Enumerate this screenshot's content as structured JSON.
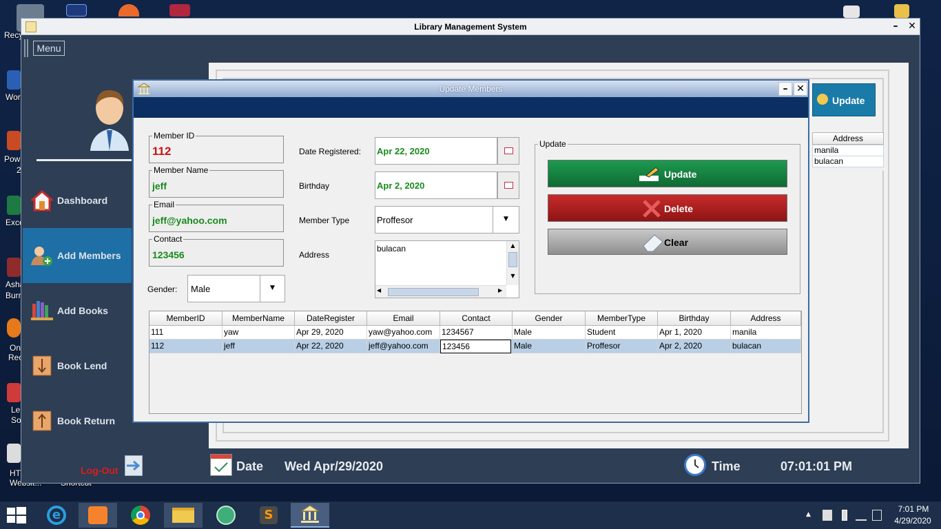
{
  "desktop": {
    "icons": [
      {
        "label": "Recy"
      },
      {
        "label": "Wor"
      },
      {
        "label": "Pow"
      },
      {
        "label": "2"
      },
      {
        "label": "Exce"
      },
      {
        "label": "Asha"
      },
      {
        "label": "Burn"
      },
      {
        "label": "On"
      },
      {
        "label": "Rec"
      },
      {
        "label": "Le"
      },
      {
        "label": "So"
      },
      {
        "label": "HT"
      },
      {
        "label": "Websit..."
      },
      {
        "label": "Shortcut"
      }
    ]
  },
  "main_window": {
    "title": "Library Management System",
    "minimize": "–",
    "close": "✕",
    "menu_label": "Menu",
    "sidebar": [
      {
        "label": "Dashboard",
        "icon": "house-icon"
      },
      {
        "label": "Add Members",
        "icon": "add-member-icon",
        "active": true
      },
      {
        "label": "Add Books",
        "icon": "books-icon"
      },
      {
        "label": "Book Lend",
        "icon": "lend-icon"
      },
      {
        "label": "Book Return",
        "icon": "return-icon"
      }
    ],
    "logout_label": "Log-Out",
    "background_update_label": "Update",
    "background_address_header": "Address",
    "background_addresses": [
      "manila",
      "bulacan"
    ],
    "status": {
      "date_label": "Date",
      "date_value": "Wed Apr/29/2020",
      "time_label": "Time",
      "time_value": "07:01:01 PM"
    }
  },
  "dialog": {
    "title": "Update Members",
    "minimize": "–",
    "close": "✕",
    "member_id": {
      "caption": "Member ID",
      "value": "112"
    },
    "member_name": {
      "caption": "Member Name",
      "value": "jeff"
    },
    "email": {
      "caption": "Email",
      "value": "jeff@yahoo.com"
    },
    "contact": {
      "caption": "Contact",
      "value": "123456"
    },
    "gender": {
      "label": "Gender:",
      "value": "Male"
    },
    "date_registered": {
      "label": "Date Registered:",
      "value": "Apr 22, 2020"
    },
    "birthday": {
      "label": "Birthday",
      "value": "Apr 2, 2020"
    },
    "member_type": {
      "label": "Member Type",
      "value": "Proffesor"
    },
    "address": {
      "label": "Address",
      "value": "bulacan"
    },
    "update_group": {
      "caption": "Update",
      "update_label": "Update",
      "delete_label": "Delete",
      "clear_label": "Clear"
    },
    "table": {
      "columns": [
        "MemberID",
        "MemberName",
        "DateRegister",
        "Email",
        "Contact",
        "Gender",
        "MemberType",
        "Birthday",
        "Address"
      ],
      "rows": [
        [
          "111",
          "yaw",
          "Apr 29, 2020",
          "yaw@yahoo.com",
          "1234567",
          "Male",
          "Student",
          "Apr 1, 2020",
          "manila"
        ],
        [
          "112",
          "jeff",
          "Apr 22, 2020",
          "jeff@yahoo.com",
          "123456",
          "Male",
          "Proffesor",
          "Apr 2, 2020",
          "bulacan"
        ]
      ],
      "selected_row": 1
    }
  },
  "taskbar": {
    "time": "7:01 PM",
    "date": "4/29/2020"
  },
  "colors": {
    "window_bg": "#2d3e55",
    "sidebar_active": "#1d6fa5",
    "dialog_band": "#0b2f63",
    "update_btn": "#137a3c",
    "delete_btn": "#a11f1f",
    "clear_btn": "#9e9e9e",
    "field_value_green": "#188a1c",
    "member_id_red": "#c81414",
    "selected_row": "#b8cfe5"
  }
}
